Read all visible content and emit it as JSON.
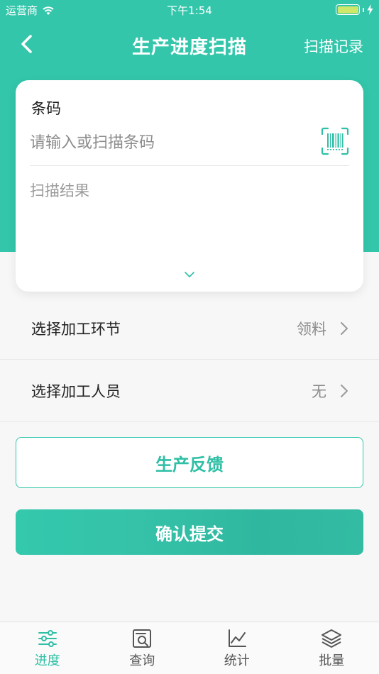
{
  "status_bar": {
    "carrier": "运营商",
    "time": "下午1:54"
  },
  "nav": {
    "title": "生产进度扫描",
    "action_label": "扫描记录"
  },
  "barcode_card": {
    "label": "条码",
    "input_placeholder": "请输入或扫描条码",
    "input_value": "",
    "result_placeholder": "扫描结果"
  },
  "rows": [
    {
      "label": "选择加工环节",
      "value": "领料"
    },
    {
      "label": "选择加工人员",
      "value": "无"
    }
  ],
  "buttons": {
    "feedback_label": "生产反馈",
    "submit_label": "确认提交"
  },
  "tabbar": {
    "items": [
      {
        "label": "进度",
        "icon": "sliders-icon",
        "active": true
      },
      {
        "label": "查询",
        "icon": "search-document-icon",
        "active": false
      },
      {
        "label": "统计",
        "icon": "line-chart-icon",
        "active": false
      },
      {
        "label": "批量",
        "icon": "layers-icon",
        "active": false
      }
    ]
  },
  "colors": {
    "brand": "#33c6ab",
    "brand_text": "#2ebfa5",
    "battery": "#cde86b"
  }
}
